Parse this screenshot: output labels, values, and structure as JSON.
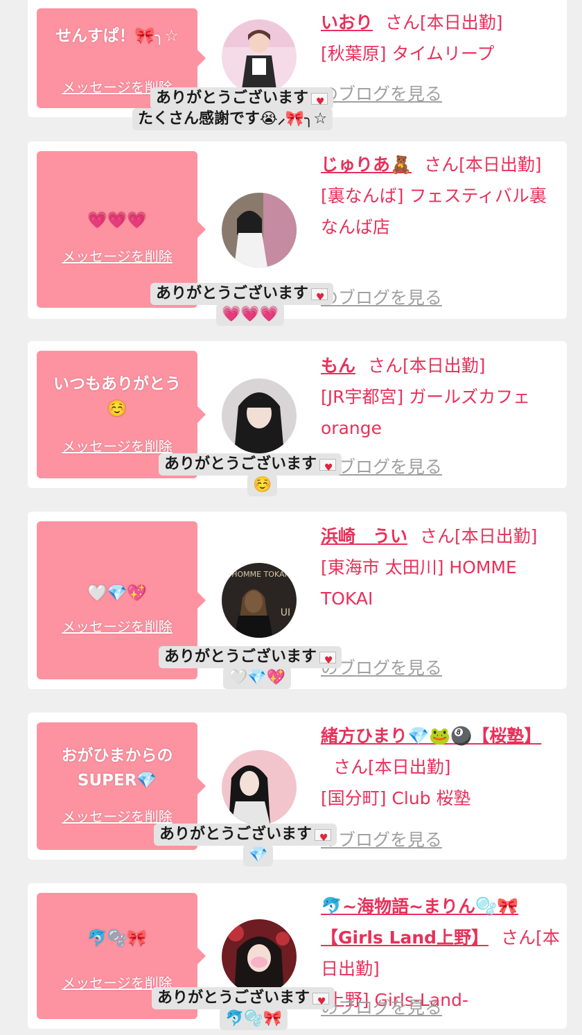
{
  "common": {
    "delete_label": "メッセージを削除",
    "blog_label": "のブログを見る",
    "thanks_label": "ありがとうございます",
    "san_suffix": "さん[本日出勤]"
  },
  "colors": {
    "accent": "#e8305a",
    "bubble": "#fd93a1",
    "caption_bg": "#e4e4e4"
  },
  "entries": [
    {
      "message": "せんすぱ！🎀╮☆",
      "name": "いおり",
      "store": "[秋葉原] タイムリープ",
      "caption_line2": "たくさん感謝です😭⸝🎀╮☆",
      "avatar_icon": "girl-avatar-pink"
    },
    {
      "message": "💗💗💗",
      "name": "じゅりあ🧸",
      "store": "[裏なんば] フェスティバル裏なんば店",
      "caption_line2": "💗💗💗",
      "avatar_icon": "girl-avatar-bw"
    },
    {
      "message": "いつもありがとう☺️",
      "name": "もん",
      "store": "[JR宇都宮] ガールズカフェorange",
      "caption_line2": "☺️",
      "avatar_icon": "girl-avatar-dark"
    },
    {
      "message": "🤍💎💖",
      "name": "浜崎　うい",
      "store": "[東海市 太田川] HOMME TOKAI",
      "caption_line2": "🤍💎💖",
      "avatar_icon": "girl-avatar-poster",
      "avatar_text": "HOMME TOKAI UI"
    },
    {
      "message": "おがひまからのSUPER💎",
      "name": "緒方ひまり💎🐸🎱【桜塾】",
      "store": "[国分町] Club 桜塾",
      "caption_line2": "💎",
      "avatar_icon": "girl-avatar-pinkbg"
    },
    {
      "message": "🐬🫧🎀",
      "name": "🐬~海物語~まりん🫧🎀【Girls Land上野】",
      "store": "[上野] Girls-Land-",
      "caption_line2": "🐬🫧🎀",
      "avatar_icon": "girl-avatar-redbg"
    }
  ]
}
